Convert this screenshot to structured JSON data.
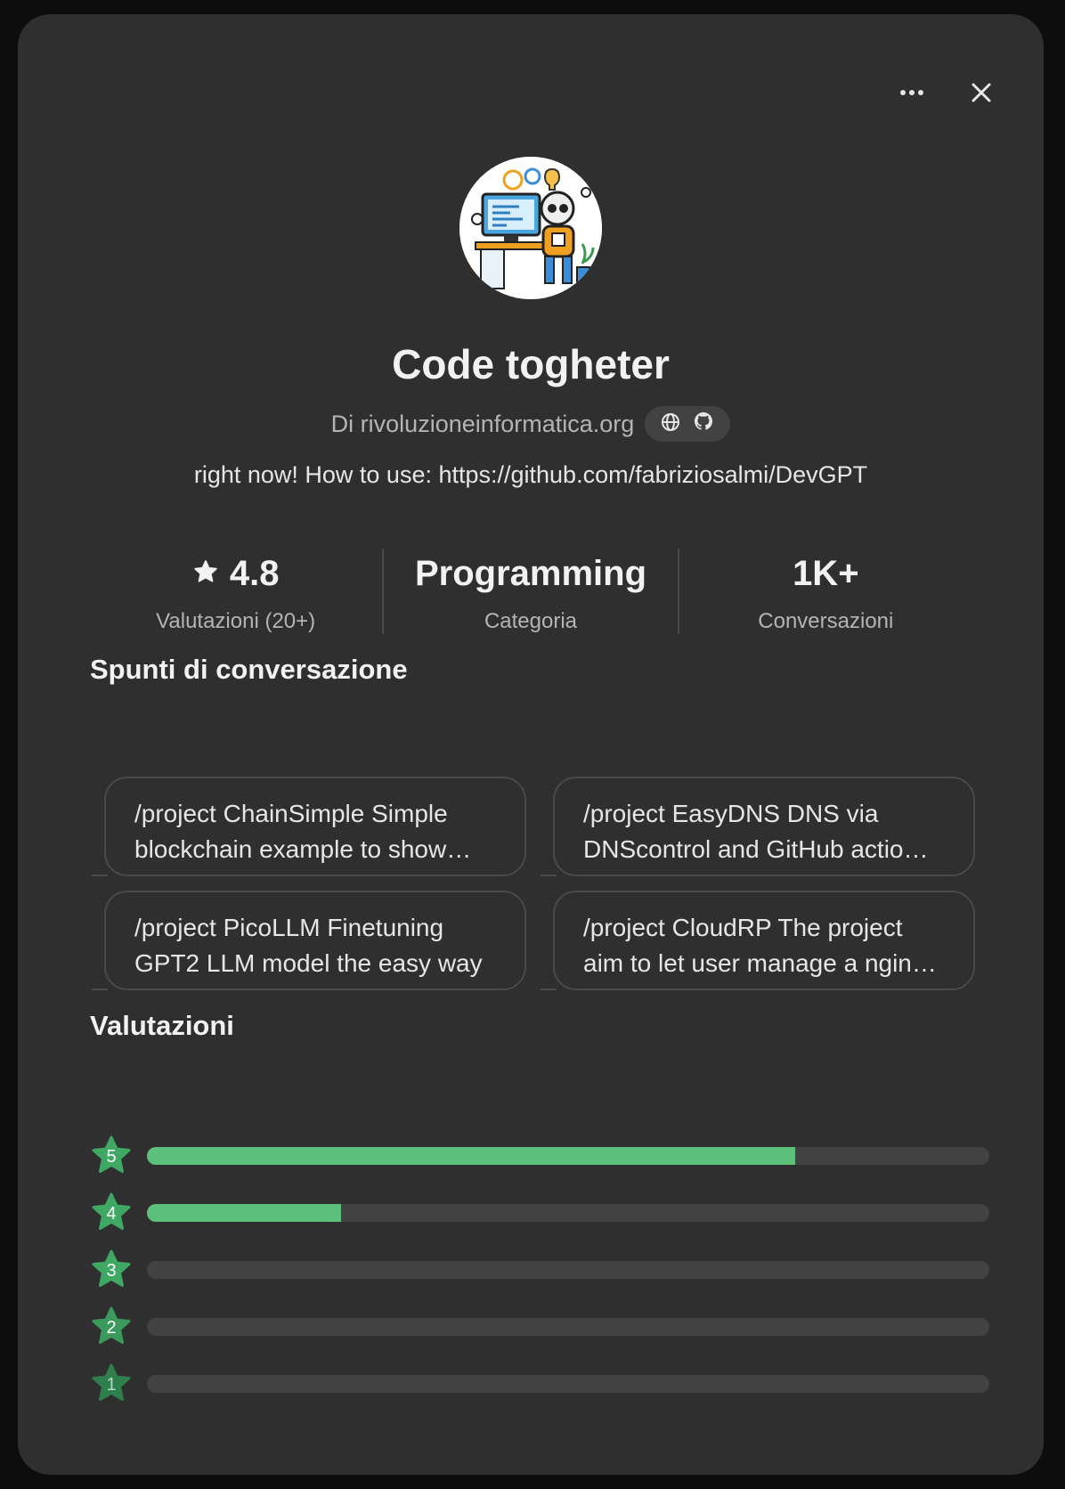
{
  "header": {
    "more_icon": "ellipsis-icon",
    "close_icon": "close-icon"
  },
  "gpt": {
    "name": "Code togheter",
    "author": "Di rivoluzioneinformatica.org",
    "links": [
      "globe-icon",
      "github-icon"
    ],
    "description": "right now! How to use: https://github.com/fabriziosalmi/DevGPT"
  },
  "stats": [
    {
      "value": "4.8",
      "label": "Valutazioni (20+)",
      "icon": "star-icon"
    },
    {
      "value": "Programming",
      "label": "Categoria"
    },
    {
      "value": "1K+",
      "label": "Conversazioni"
    }
  ],
  "starters": {
    "title": "Spunti di conversazione",
    "items": [
      "/project ChainSimple Simple blockchain example to show…",
      "/project EasyDNS DNS via DNScontrol and GitHub actio…",
      "/project PicoLLM Finetuning GPT2 LLM model the easy way",
      "/project CloudRP The project aim to let user manage a ngin…"
    ]
  },
  "ratings": {
    "title": "Valutazioni",
    "rows": [
      {
        "stars": "5",
        "fraction": 0.77
      },
      {
        "stars": "4",
        "fraction": 0.23
      },
      {
        "stars": "3",
        "fraction": 0.0
      },
      {
        "stars": "2",
        "fraction": 0.0
      },
      {
        "stars": "1",
        "fraction": 0.0
      }
    ]
  },
  "colors": {
    "accent_green": "#5cbf7a",
    "badge_green_strong": "#3fa865",
    "badge_green_faint": "#2f7f4c"
  }
}
